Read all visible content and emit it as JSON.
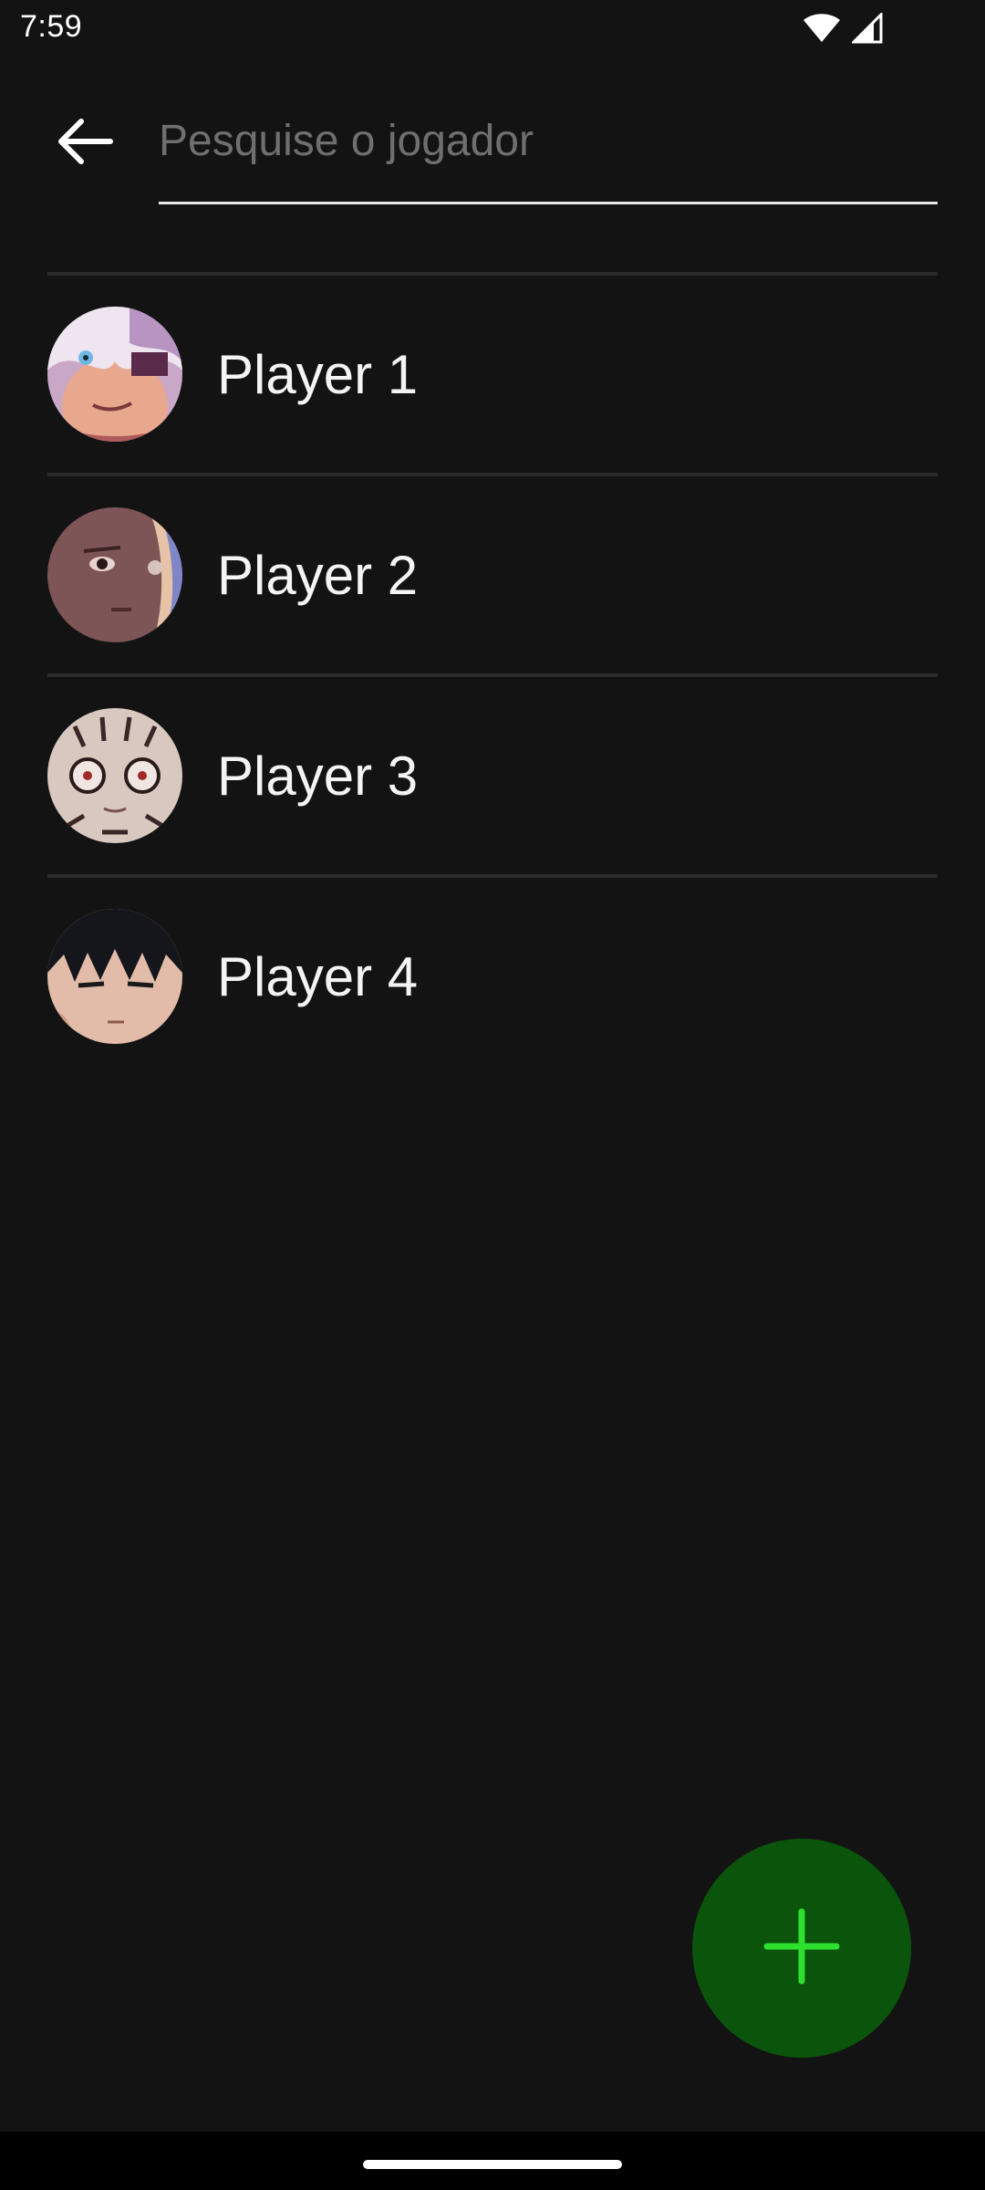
{
  "status_bar": {
    "time": "7:59",
    "icons": [
      "wifi-icon",
      "cell-signal-icon"
    ]
  },
  "search": {
    "placeholder": "Pesquise o jogador",
    "value": ""
  },
  "players": [
    {
      "name": "Player 1",
      "avatar": "avatar-white-hair"
    },
    {
      "name": "Player 2",
      "avatar": "avatar-brown-hair"
    },
    {
      "name": "Player 3",
      "avatar": "avatar-face-marks"
    },
    {
      "name": "Player 4",
      "avatar": "avatar-black-hair"
    }
  ],
  "fab": {
    "icon": "plus-icon"
  },
  "colors": {
    "background": "#131313",
    "divider": "#2b2b2b",
    "fab_background": "#0a540c",
    "fab_icon": "#2ee02e",
    "placeholder": "#6f6f6f"
  }
}
